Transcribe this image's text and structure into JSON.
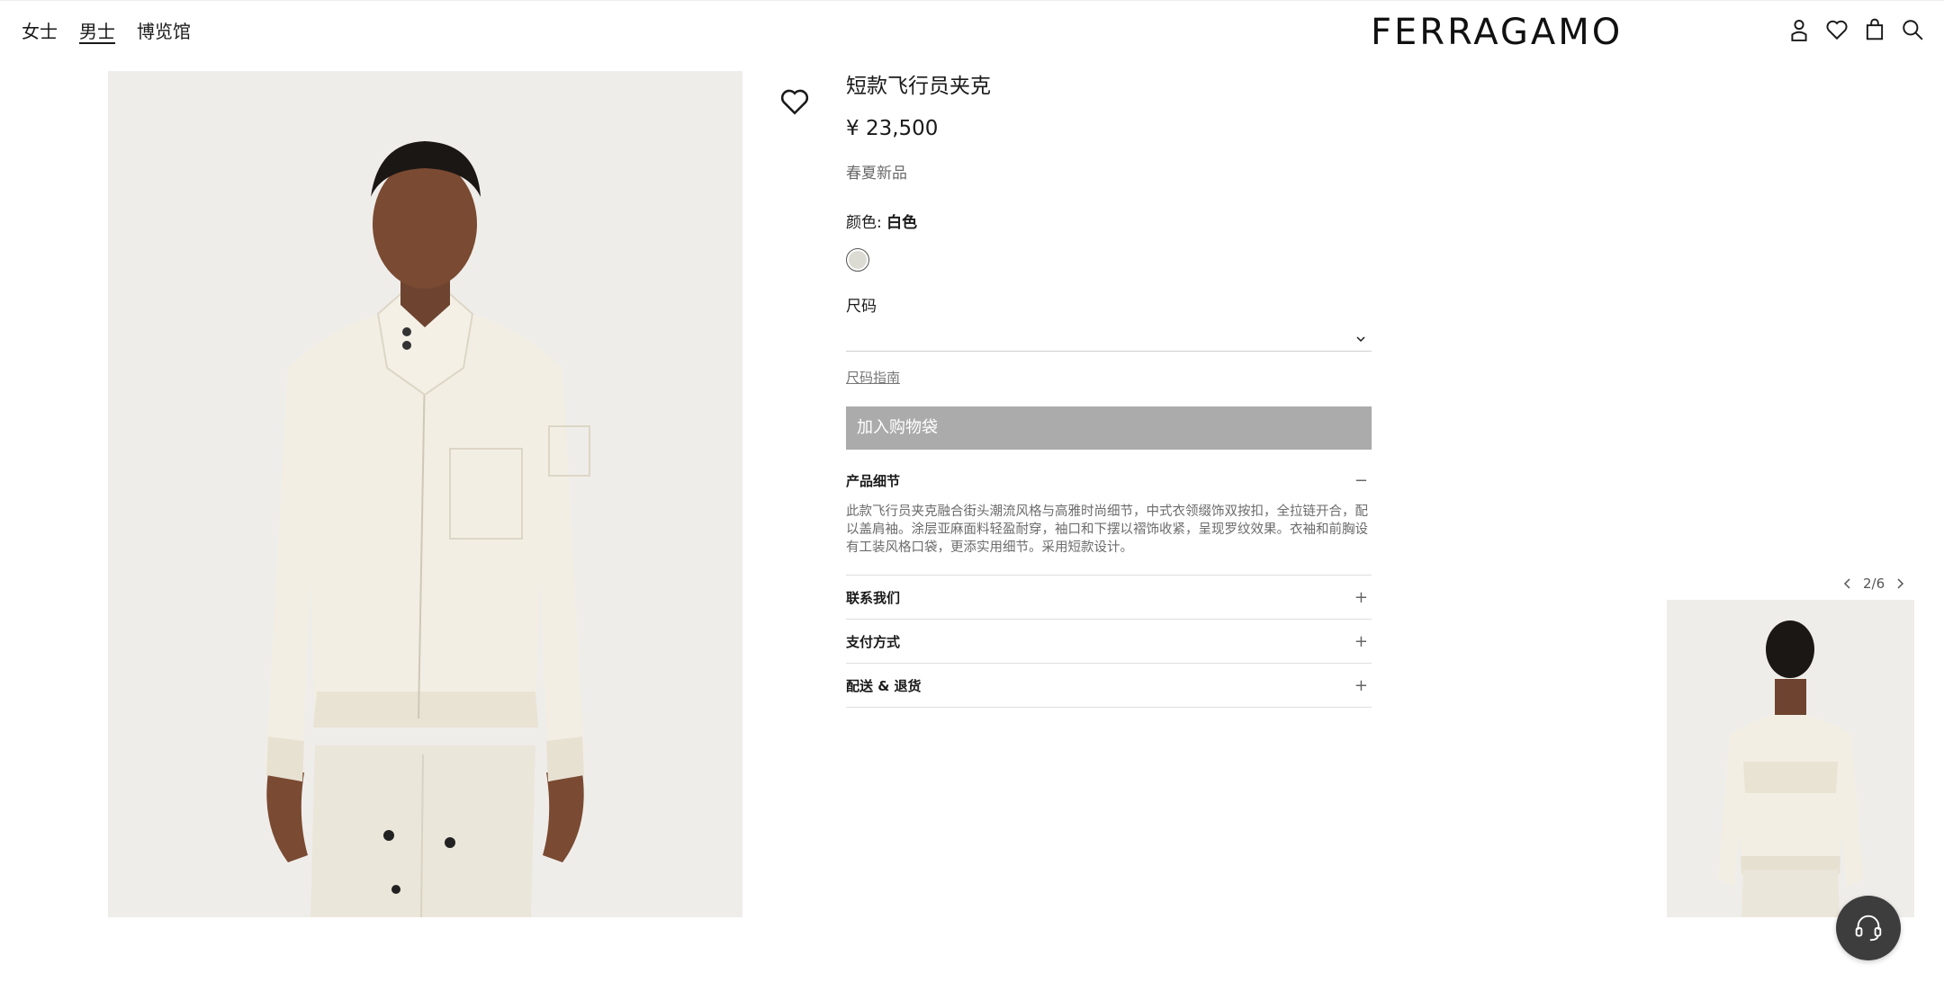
{
  "header": {
    "nav": [
      "女士",
      "男士",
      "博览馆"
    ],
    "active_nav": "男士",
    "logo": "FERRAGAMO",
    "icons": [
      "account-icon",
      "wishlist-icon",
      "bag-icon",
      "search-icon"
    ]
  },
  "product": {
    "title": "短款飞行员夹克",
    "price": "¥ 23,500",
    "tag": "春夏新品",
    "color_label": "颜色:",
    "color_value": "白色",
    "swatch_color": "#dcdbd3",
    "size_label": "尺码",
    "size_guide": "尺码指南",
    "add_to_bag": "加入购物袋"
  },
  "accordion": {
    "details": {
      "title": "产品细节",
      "sign": "−",
      "body": "此款飞行员夹克融合街头潮流风格与高雅时尚细节，中式衣领缀饰双按扣，全拉链开合，配以盖肩袖。涂层亚麻面料轻盈耐穿，袖口和下摆以褶饰收紧，呈现罗纹效果。衣袖和前胸设有工装风格口袋，更添实用细节。采用短款设计。"
    },
    "items": [
      {
        "title": "联系我们",
        "sign": "+"
      },
      {
        "title": "支付方式",
        "sign": "+"
      },
      {
        "title": "配送 & 退货",
        "sign": "+"
      }
    ]
  },
  "gallery": {
    "pager": "2/6"
  },
  "colors": {
    "button_disabled": "#ababab",
    "image_bg": "#efedea",
    "chat_bg": "#3d3d3d"
  }
}
